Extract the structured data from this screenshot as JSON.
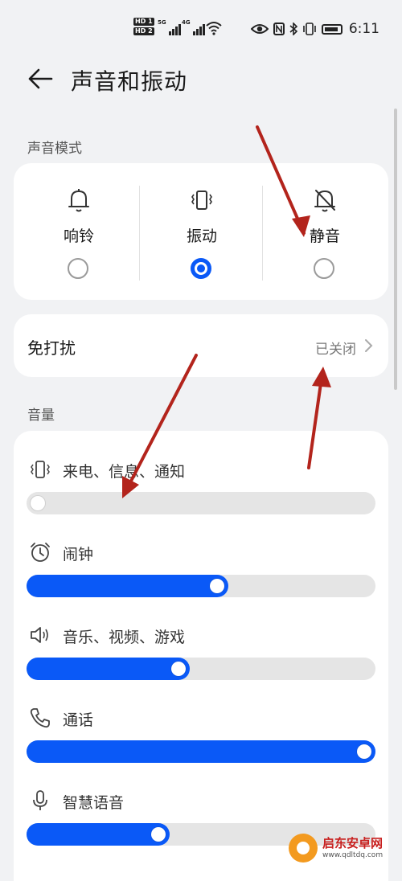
{
  "status_bar": {
    "hd_top": "HD 1",
    "hd_bottom": "HD 2",
    "sig1_label": "5G",
    "sig2_label": "4G",
    "time": "6:11",
    "icons": [
      "eye-icon",
      "nfc-icon",
      "bluetooth-icon",
      "vibrate-icon",
      "battery-icon"
    ]
  },
  "header": {
    "title": "声音和振动",
    "back_icon": "arrow-left-icon"
  },
  "sound_mode": {
    "section_label": "声音模式",
    "modes": [
      {
        "label": "响铃",
        "icon": "bell-icon",
        "selected": false
      },
      {
        "label": "振动",
        "icon": "vibrate-icon",
        "selected": true
      },
      {
        "label": "静音",
        "icon": "bell-off-icon",
        "selected": false
      }
    ]
  },
  "dnd": {
    "title": "免打扰",
    "value": "已关闭"
  },
  "volume": {
    "section_label": "音量",
    "items": [
      {
        "label": "来电、信息、通知",
        "icon": "vibrate-icon",
        "level": 0.0
      },
      {
        "label": "闹钟",
        "icon": "alarm-clock-icon",
        "level": 0.55
      },
      {
        "label": "音乐、视频、游戏",
        "icon": "speaker-icon",
        "level": 0.43
      },
      {
        "label": "通话",
        "icon": "phone-icon",
        "level": 1.0
      },
      {
        "label": "智慧语音",
        "icon": "microphone-icon",
        "level": 0.37
      }
    ]
  },
  "colors": {
    "accent": "#0a59f7",
    "background": "#f1f2f4",
    "annotation_arrow": "#b3241c"
  },
  "watermark": {
    "line1": "启东安卓网",
    "line2": "www.qdltdq.com"
  }
}
